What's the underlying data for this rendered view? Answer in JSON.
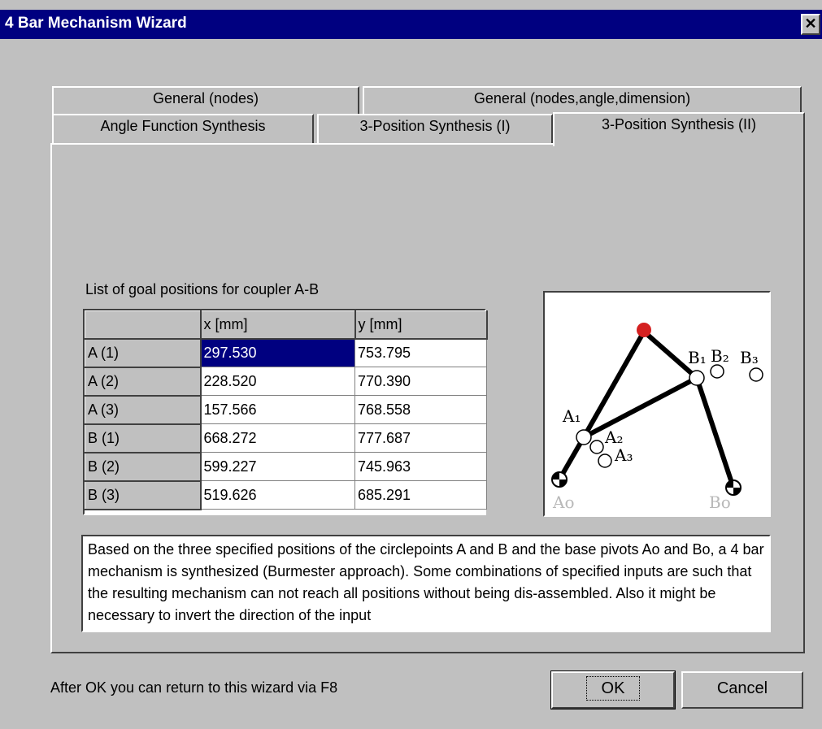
{
  "window": {
    "title": "4 Bar Mechanism Wizard",
    "close_glyph": "✕"
  },
  "tabs": {
    "row1": [
      {
        "label": "General (nodes)"
      },
      {
        "label": "General (nodes,angle,dimension)"
      }
    ],
    "row2": [
      {
        "label": "Angle Function Synthesis"
      },
      {
        "label": "3-Position Synthesis (I)"
      },
      {
        "label": "3-Position Synthesis (II)",
        "active": true
      }
    ]
  },
  "table": {
    "caption": "List of goal positions for coupler A-B",
    "headers": [
      "",
      "x [mm]",
      "y [mm]"
    ],
    "rows": [
      {
        "label": "A (1)",
        "x": "297.530",
        "y": "753.795"
      },
      {
        "label": "A (2)",
        "x": "228.520",
        "y": "770.390"
      },
      {
        "label": "A (3)",
        "x": "157.566",
        "y": "768.558"
      },
      {
        "label": "B (1)",
        "x": "668.272",
        "y": "777.687"
      },
      {
        "label": "B (2)",
        "x": "599.227",
        "y": "745.963"
      },
      {
        "label": "B (3)",
        "x": "519.626",
        "y": "685.291"
      }
    ]
  },
  "diagram": {
    "labels": {
      "a1": "A₁",
      "a2": "A₂",
      "a3": "A₃",
      "b1": "B₁",
      "b2": "B₂",
      "b3": "B₃",
      "ao": "Ao",
      "bo": "Bo"
    },
    "colors": {
      "coupler_point": "#d42020",
      "link": "#000000",
      "base_label": "#b8b8b8"
    }
  },
  "description": "Based on the three specified positions of the circlepoints A and B and the base pivots Ao and Bo, a 4 bar mechanism is synthesized (Burmester approach). Some combinations of specified inputs are such that the resulting mechanism can not reach all positions without being dis-assembled. Also it might be necessary to invert the direction of the input",
  "footer": {
    "note": "After OK you can return to this wizard via F8",
    "ok_label": "OK",
    "cancel_label": "Cancel"
  }
}
